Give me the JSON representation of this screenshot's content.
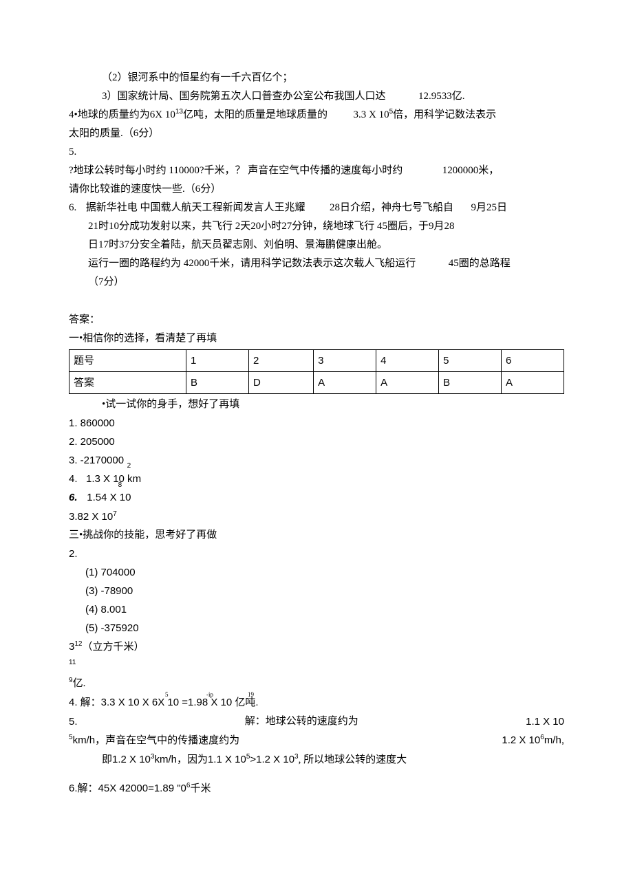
{
  "q2_2": "（2）银河系中的恒星约有一千六百亿个；",
  "q2_3_a": "3）国家统计局、国务院第五次人口普查办公室公布我国人口达",
  "q2_3_b": "12.9533亿.",
  "q4_a": "4•地球的质量约为6X 10",
  "q4_sup1": "13",
  "q4_b": "亿吨，太阳的质量是地球质量的",
  "q4_c": "3.3 X 10",
  "q4_sup2": "5",
  "q4_d": "倍，用科学记数法表示",
  "q4_e": "太阳的质量.（6分）",
  "q5_label": "5.",
  "q5_a": "?地球公转时每小时约 110000?千米，？ 声音在空气中传播的速度每小时约",
  "q5_b": "1200000米，",
  "q5_c": "请你比较谁的速度快一些.（6分）",
  "q6_label": "6.",
  "q6_a": "据新华社电 中国载人航天工程新闻发言人王兆耀",
  "q6_b": "28日介绍，神舟七号飞船自",
  "q6_c": "9月25日",
  "q6_d": "21时10分成功发射以来，共飞行 2天20小时27分钟，绕地球飞行 45圈后，于9月28",
  "q6_e": "日17时37分安全着陆，航天员翟志刚、刘伯明、景海鹏健康出舱。",
  "q6_f": "运行一圈的路程约为 42000千米，请用科学记数法表示这次载人飞船运行",
  "q6_g": "45圈的总路程",
  "q6_h": "（7分）",
  "ans_label": "答案：",
  "sec1_title": "一•相信你的选择，看清楚了再填",
  "table": {
    "r1": [
      "题号",
      "1",
      "2",
      "3",
      "4",
      "5",
      "6"
    ],
    "r2": [
      "答案",
      "B",
      "D",
      "A",
      "A",
      "B",
      "A"
    ]
  },
  "sec2_title": "•试一试你的身手，想好了再填",
  "a1": "1.   860000",
  "a2": "2.   205000",
  "a3": "3.   -2170000",
  "a4_a": "4.   1.3 X 10 km",
  "a4_sup": "2",
  "a6_num": "6.",
  "a6_a": "1.54 X 10",
  "a6_sup": "8",
  "a382": "3.82 X 10",
  "a382_sup": "7",
  "sec3_title": "三•挑战你的技能，思考好了再做",
  "b2_label": "2.",
  "b2_1": "(1)   704000",
  "b2_3": "(3)   -78900",
  "b2_4": "(4)   8.001",
  "b2_5": "(5)   -375920",
  "c312": "3",
  "c312_sup": "12",
  "c312_txt": "（立方千米）",
  "c11": "11",
  "c9yi_sup": "9",
  "c9yi": "亿.",
  "d4_a": "4.   解：3.3 X 10 X 6X 10 =1.98 X 10 亿吨.",
  "d4_s1": "5",
  "d4_s2": "-ip",
  "d4_s3": "19",
  "d5_a": "5.",
  "d5_b": "解：地球公转的速度约为",
  "d5_c": "1.1 X 10",
  "d5_sup1": "5",
  "d5_d": "km/h，声音在空气中的传播速度约为",
  "d5_e": "1.2 X 10",
  "d5_sup2": "6",
  "d5_f": "m/h,",
  "d5_g": "即1.2 X 10",
  "d5_sup3": "3",
  "d5_h": "km/h，因为1.1 X 10",
  "d5_sup4": "5",
  "d5_i": ">1.2 X 10",
  "d5_sup5": "3",
  "d5_j": ", 所以地球公转的速度大",
  "d6": "6.解：45X 42000=1.89 \"0",
  "d6_sup": "6",
  "d6_b": "千米"
}
